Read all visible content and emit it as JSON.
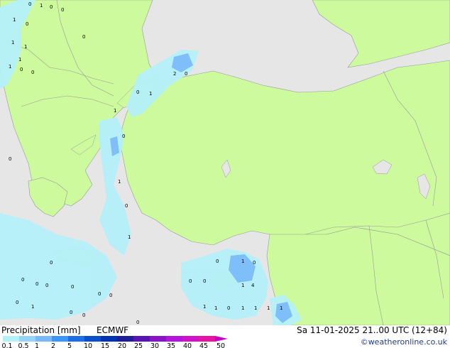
{
  "footer": {
    "title": "Precipitation [mm]",
    "model": "ECMWF",
    "valid_time": "Sa 11-01-2025 21..00 UTC (12+84)",
    "credit": "©weatheronline.co.uk"
  },
  "legend": {
    "ticks": [
      "0.1",
      "0.5",
      "1",
      "2",
      "5",
      "10",
      "15",
      "20",
      "25",
      "30",
      "35",
      "40",
      "45",
      "50"
    ],
    "colors": [
      "#b4f0fa",
      "#96d2fa",
      "#78b9fa",
      "#3c96f5",
      "#1e6ee6",
      "#0a50c8",
      "#0032b4",
      "#1e1e96",
      "#5a14b4",
      "#8c14c8",
      "#b414dc",
      "#d214c8",
      "#e614a0",
      "#c800c8"
    ]
  },
  "colors": {
    "land": "#ccfa9c",
    "sea": "#e6e6e6",
    "border": "#9a9a9a",
    "precip_light": "#b4f0fa",
    "precip_mid": "#78b9fa"
  },
  "map": {
    "station_values": [
      "0",
      "1",
      "0",
      "1",
      "0",
      "1",
      "1",
      "1",
      "0",
      "1",
      "0",
      "0",
      "0",
      "0",
      "2",
      "0",
      "1",
      "1",
      "0",
      "1",
      "0",
      "0",
      "0",
      "1",
      "0",
      "0",
      "0",
      "0",
      "0",
      "0",
      "0",
      "1",
      "0",
      "0",
      "0",
      "1",
      "0",
      "0",
      "1",
      "4",
      "1",
      "1",
      "0",
      "1",
      "1",
      "1",
      "1",
      "0",
      "0"
    ]
  }
}
